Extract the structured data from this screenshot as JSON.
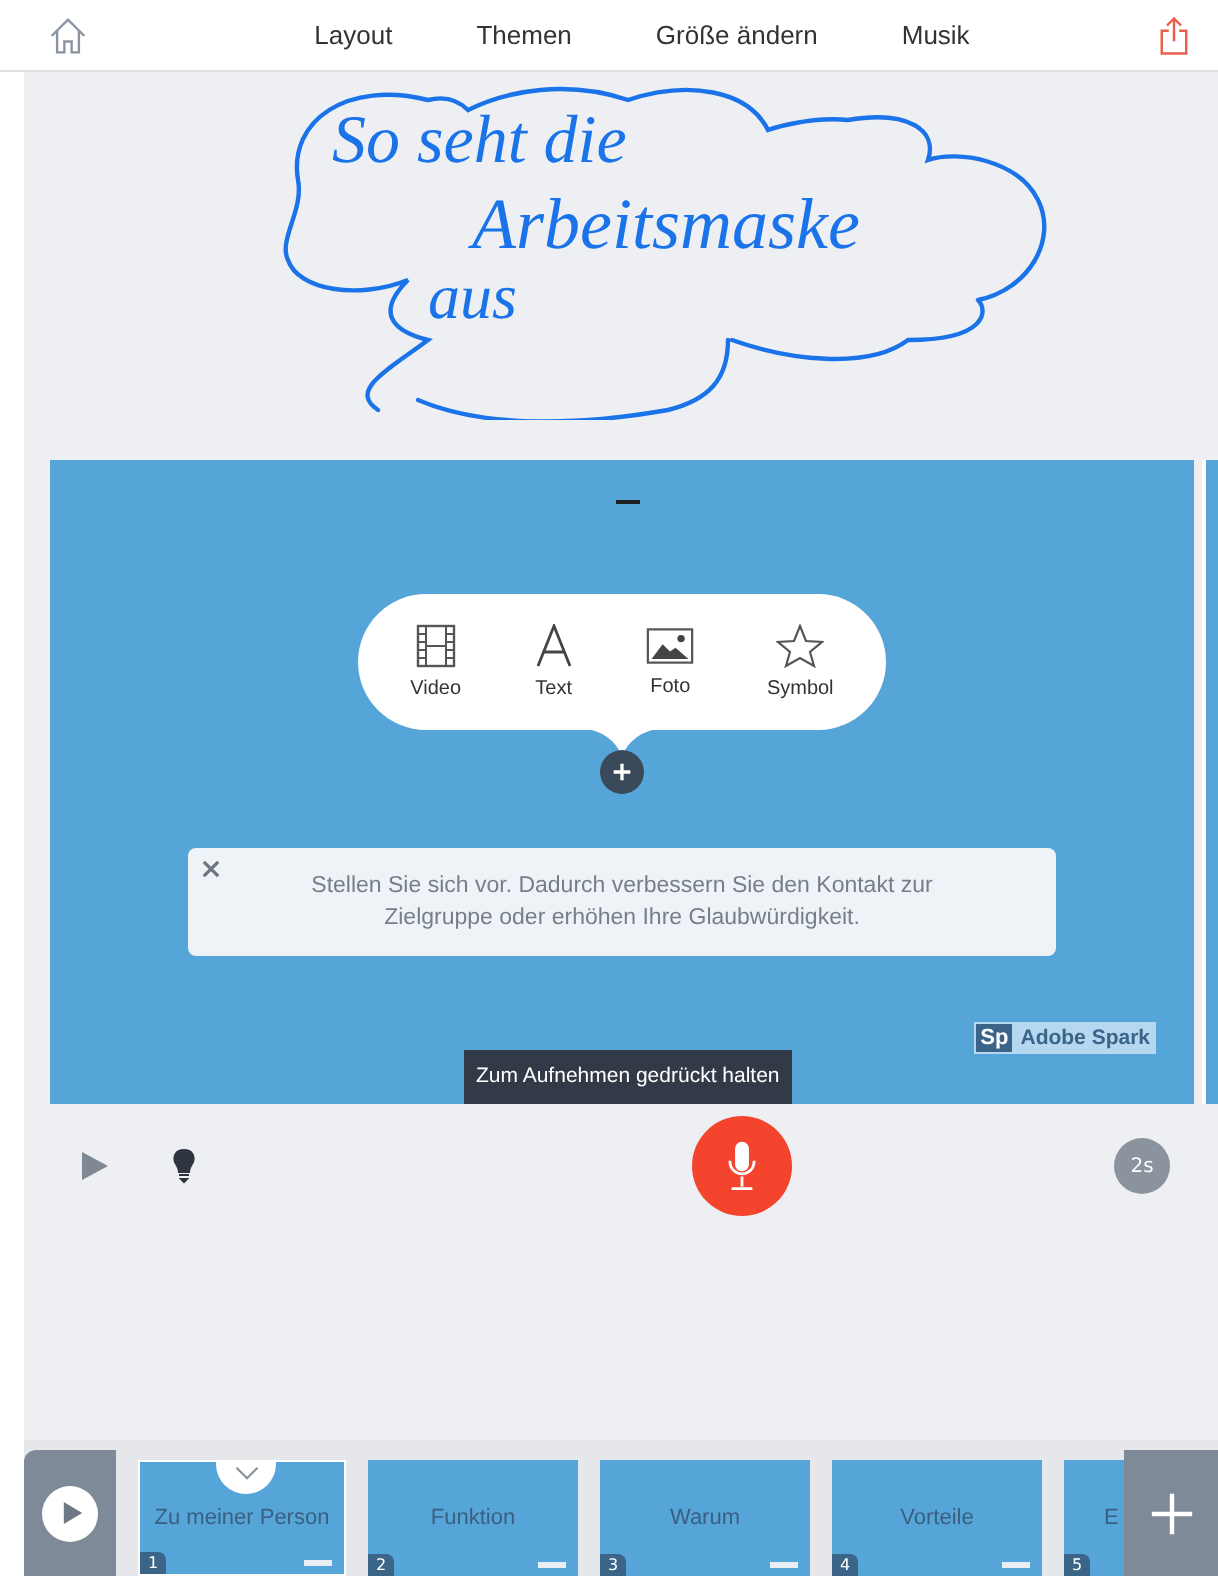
{
  "toolbar": {
    "tabs": [
      {
        "label": "Layout"
      },
      {
        "label": "Themen"
      },
      {
        "label": "Größe ändern"
      },
      {
        "label": "Musik"
      }
    ]
  },
  "annotation": {
    "lines": [
      "So seht die",
      "Arbeitsmaske",
      "aus"
    ]
  },
  "slide": {
    "add_menu": {
      "options": [
        {
          "kind": "video",
          "label": "Video"
        },
        {
          "kind": "text",
          "label": "Text"
        },
        {
          "kind": "photo",
          "label": "Foto"
        },
        {
          "kind": "symbol",
          "label": "Symbol"
        }
      ]
    },
    "hint": "Stellen Sie sich vor. Dadurch verbessern Sie den Kontakt zur Zielgruppe oder erhöhen Ihre Glaubwürdigkeit.",
    "badge": {
      "logo": "Sp",
      "label": "Adobe Spark"
    }
  },
  "record_tooltip": "Zum Aufnehmen gedrückt halten",
  "duration": "2s",
  "filmstrip": {
    "slides": [
      {
        "number": "1",
        "title": "Zu meiner Person",
        "selected": true
      },
      {
        "number": "2",
        "title": "Funktion",
        "selected": false
      },
      {
        "number": "3",
        "title": "Warum",
        "selected": false
      },
      {
        "number": "4",
        "title": "Vorteile",
        "selected": false
      },
      {
        "number": "5",
        "title": "E",
        "selected": false
      }
    ]
  }
}
